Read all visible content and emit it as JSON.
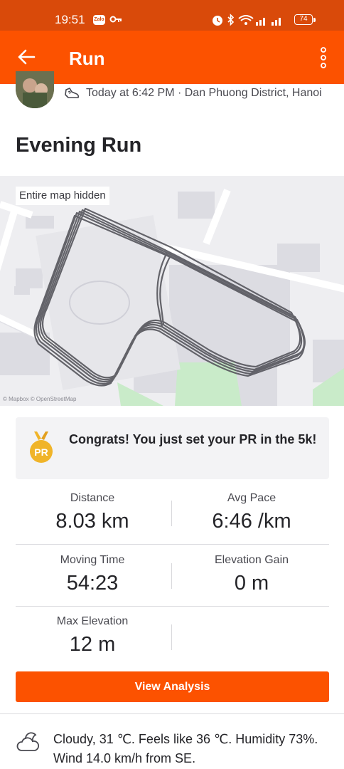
{
  "status_bar": {
    "time": "19:51",
    "zalo_label": "Zalo",
    "battery": "74"
  },
  "app_bar": {
    "title": "Run"
  },
  "activity": {
    "meta": "Today at 6:42 PM · Dan Phuong District, Hanoi",
    "title": "Evening Run"
  },
  "map": {
    "hidden_label": "Entire map hidden",
    "attribution": "© Mapbox © OpenStreetMap"
  },
  "achievement": {
    "badge": "PR",
    "text": "Congrats! You just set your PR in the 5k!"
  },
  "stats": [
    {
      "label": "Distance",
      "value": "8.03 km"
    },
    {
      "label": "Avg Pace",
      "value": "6:46 /km"
    },
    {
      "label": "Moving Time",
      "value": "54:23"
    },
    {
      "label": "Elevation Gain",
      "value": "0 m"
    },
    {
      "label": "Max Elevation",
      "value": "12 m"
    }
  ],
  "actions": {
    "view_analysis": "View Analysis"
  },
  "weather": {
    "text": "Cloudy, 31 ℃. Feels like 36 ℃. Humidity 73%. Wind 14.0 km/h from SE."
  },
  "colors": {
    "brand": "#fc5200",
    "status_bar": "#d94a0a",
    "pr_gold": "#f0b429"
  },
  "icons": [
    "back-arrow-icon",
    "more-vertical-icon",
    "shoe-icon",
    "pr-medal-icon",
    "cloud-sun-icon",
    "key-icon",
    "alarm-icon",
    "bluetooth-icon",
    "wifi-icon",
    "signal-icon",
    "battery-icon"
  ]
}
